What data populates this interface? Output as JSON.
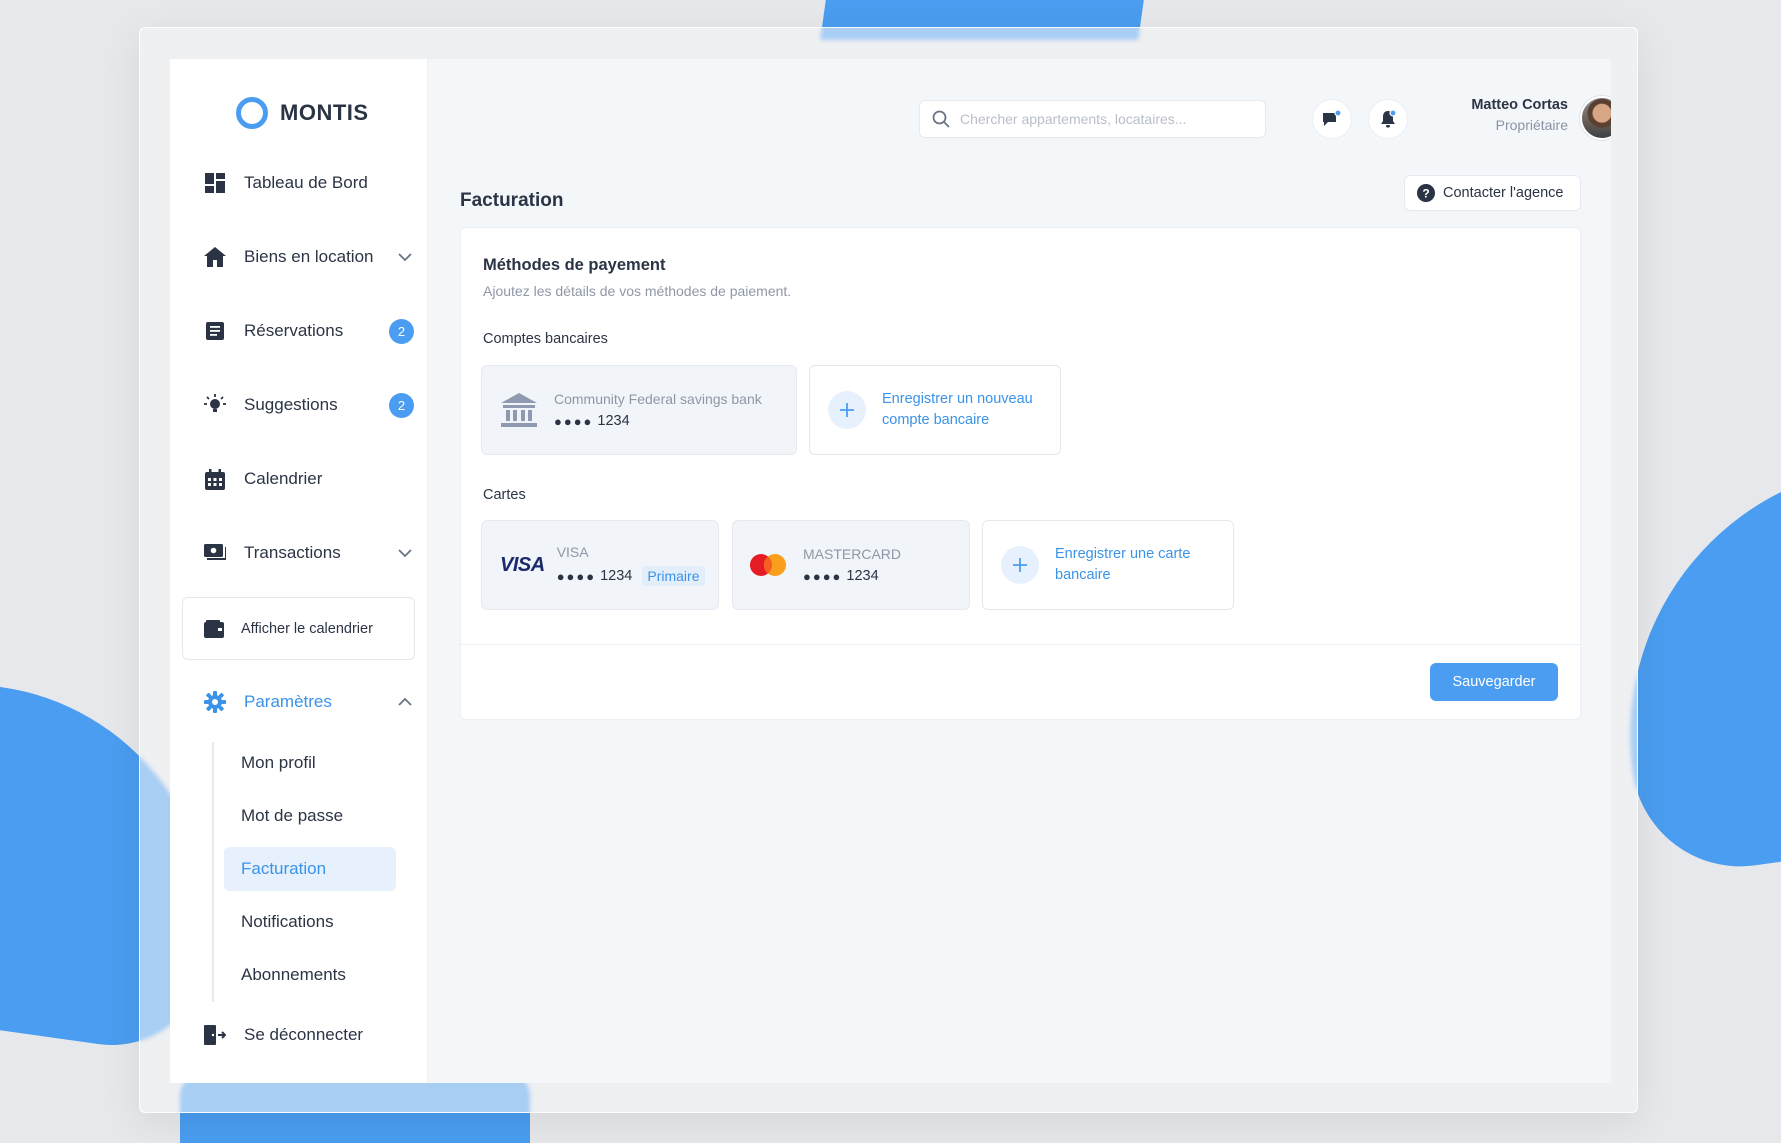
{
  "brand": {
    "name": "MONTIS",
    "accent": "#4a9df0"
  },
  "sidebar": {
    "items": [
      {
        "label": "Tableau de Bord",
        "icon": "dashboard-icon"
      },
      {
        "label": "Biens en location",
        "icon": "home-icon"
      },
      {
        "label": "Réservations",
        "icon": "list-icon",
        "badge": "2"
      },
      {
        "label": "Suggestions",
        "icon": "lightbulb-icon",
        "badge": "2"
      },
      {
        "label": "Calendrier",
        "icon": "calendar-icon"
      },
      {
        "label": "Transactions",
        "icon": "payments-icon"
      }
    ],
    "calendar_button": "Afficher le calendrier",
    "settings": {
      "label": "Paramètres",
      "subitems": [
        "Mon profil",
        "Mot de passe",
        "Facturation",
        "Notifications",
        "Abonnements"
      ],
      "active": "Facturation"
    },
    "logout": "Se déconnecter"
  },
  "header": {
    "search_placeholder": "Chercher appartements, locataires...",
    "user": {
      "name": "Matteo Cortas",
      "role": "Propriétaire"
    }
  },
  "page": {
    "title": "Facturation",
    "contact_button": "Contacter l'agence"
  },
  "payment": {
    "title": "Méthodes de payement",
    "subtitle": "Ajoutez les détails de vos méthodes de paiement.",
    "bank_section": "Comptes bancaires",
    "bank": {
      "name": "Community Federal savings bank",
      "dots": "●●●●",
      "last4": "1234"
    },
    "add_bank": "Enregistrer un nouveau compte bancaire",
    "cards_section": "Cartes",
    "cards": [
      {
        "brand": "VISA",
        "logo": "VISA",
        "dots": "●●●●",
        "last4": "1234",
        "tag": "Primaire"
      },
      {
        "brand": "MASTERCARD",
        "dots": "●●●●",
        "last4": "1234"
      }
    ],
    "add_card": "Enregistrer une carte bancaire",
    "save_button": "Sauvegarder"
  }
}
